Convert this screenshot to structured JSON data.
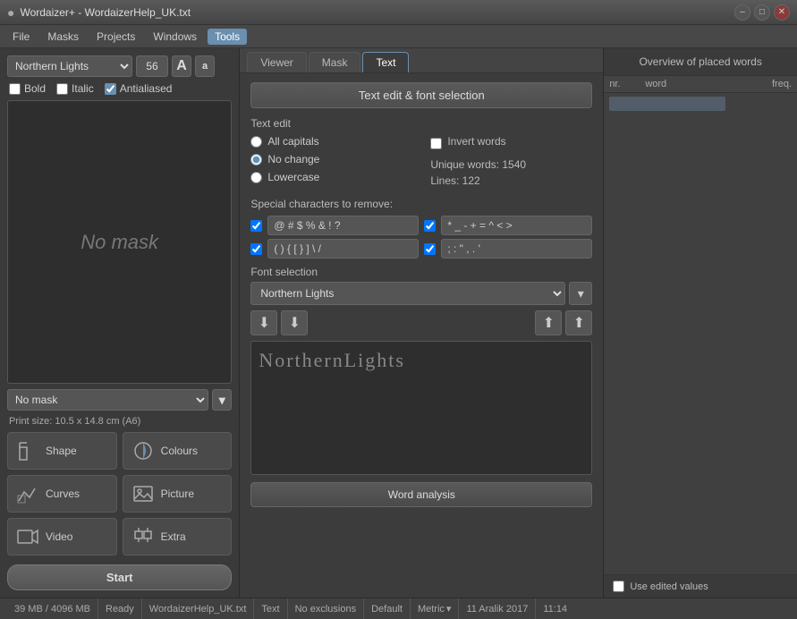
{
  "titleBar": {
    "title": "Wordaizer+ - WordaizerHelp_UK.txt"
  },
  "menuBar": {
    "items": [
      "File",
      "Masks",
      "Projects",
      "Windows",
      "Tools"
    ],
    "activeItem": "Tools"
  },
  "leftPanel": {
    "fontName": "Northern Lights",
    "fontSize": "56",
    "fontSizeLargeLabel": "A",
    "fontSizeSmallLabel": "a",
    "bold": false,
    "italic": false,
    "antialiased": true,
    "previewText": "No mask",
    "maskSelect": "No mask",
    "printSize": "Print size: 10.5 x 14.8 cm (A6)",
    "tools": [
      {
        "label": "Shape",
        "icon": "⊞"
      },
      {
        "label": "Colours",
        "icon": "◕"
      },
      {
        "label": "Curves",
        "icon": "~"
      },
      {
        "label": "Picture",
        "icon": "▦"
      },
      {
        "label": "Video",
        "icon": "▶"
      },
      {
        "label": "Extra",
        "icon": "⬡"
      }
    ],
    "startButton": "Start"
  },
  "tabs": [
    "Viewer",
    "Mask",
    "Text"
  ],
  "activeTab": "Text",
  "textEditPanel": {
    "header": "Text edit & font selection",
    "sectionLabel": "Text edit",
    "radioOptions": [
      "All capitals",
      "No change",
      "Lowercase"
    ],
    "selectedRadio": "No change",
    "invertWords": false,
    "invertWordsLabel": "Invert words",
    "uniqueWords": "Unique words: 1540",
    "lines": "Lines: 122",
    "specialCharsLabel": "Special characters to remove:",
    "specialRow1Left": "@ # $ % & ! ?",
    "specialRow1Right": "* _ - + = ^ < >",
    "specialRow2Left": "( ) { [ } ] \\ /",
    "specialRow2Right": "; : \" , . '",
    "check1Left": true,
    "check1Right": true,
    "check2Left": true,
    "check2Right": true,
    "fontSelectionLabel": "Font selection",
    "fontSelectValue": "Northern Lights",
    "fontPreviewText": "NorthernLights",
    "wordAnalysisButton": "Word analysis"
  },
  "rightPanel": {
    "header": "Overview of placed words",
    "colNr": "nr.",
    "colWord": "word",
    "colFreq": "freq.",
    "useEditedValues": false,
    "useEditedLabel": "Use edited values"
  },
  "statusBar": {
    "memory": "39 MB / 4096 MB",
    "status": "Ready",
    "filename": "WordaizerHelp_UK.txt",
    "mode": "Text",
    "exclusions": "No exclusions",
    "profile": "Default",
    "units": "Metric",
    "date": "11 Aralik 2017",
    "time": "11:14"
  }
}
